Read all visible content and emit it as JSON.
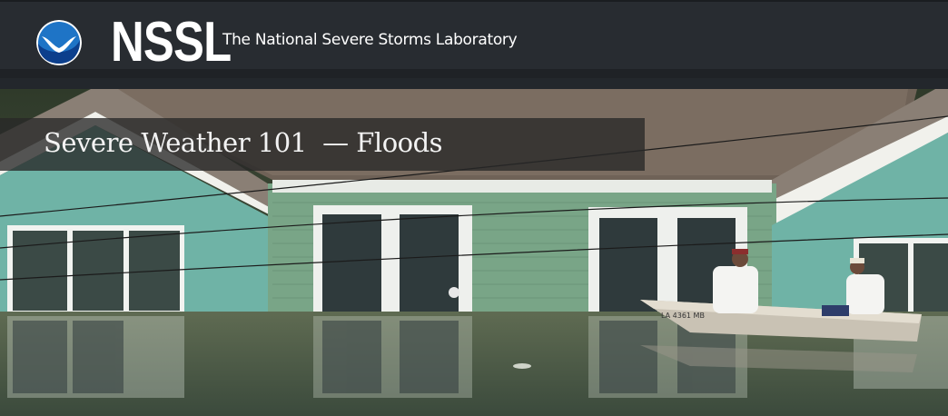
{
  "header": {
    "logo_icon": "noaa-logo-icon",
    "site_short": "NSSL",
    "site_full": "The National Severe Storms Laboratory"
  },
  "hero": {
    "title": "Severe Weather 101  — Floods",
    "boat_label": "LA 4361 MB"
  }
}
